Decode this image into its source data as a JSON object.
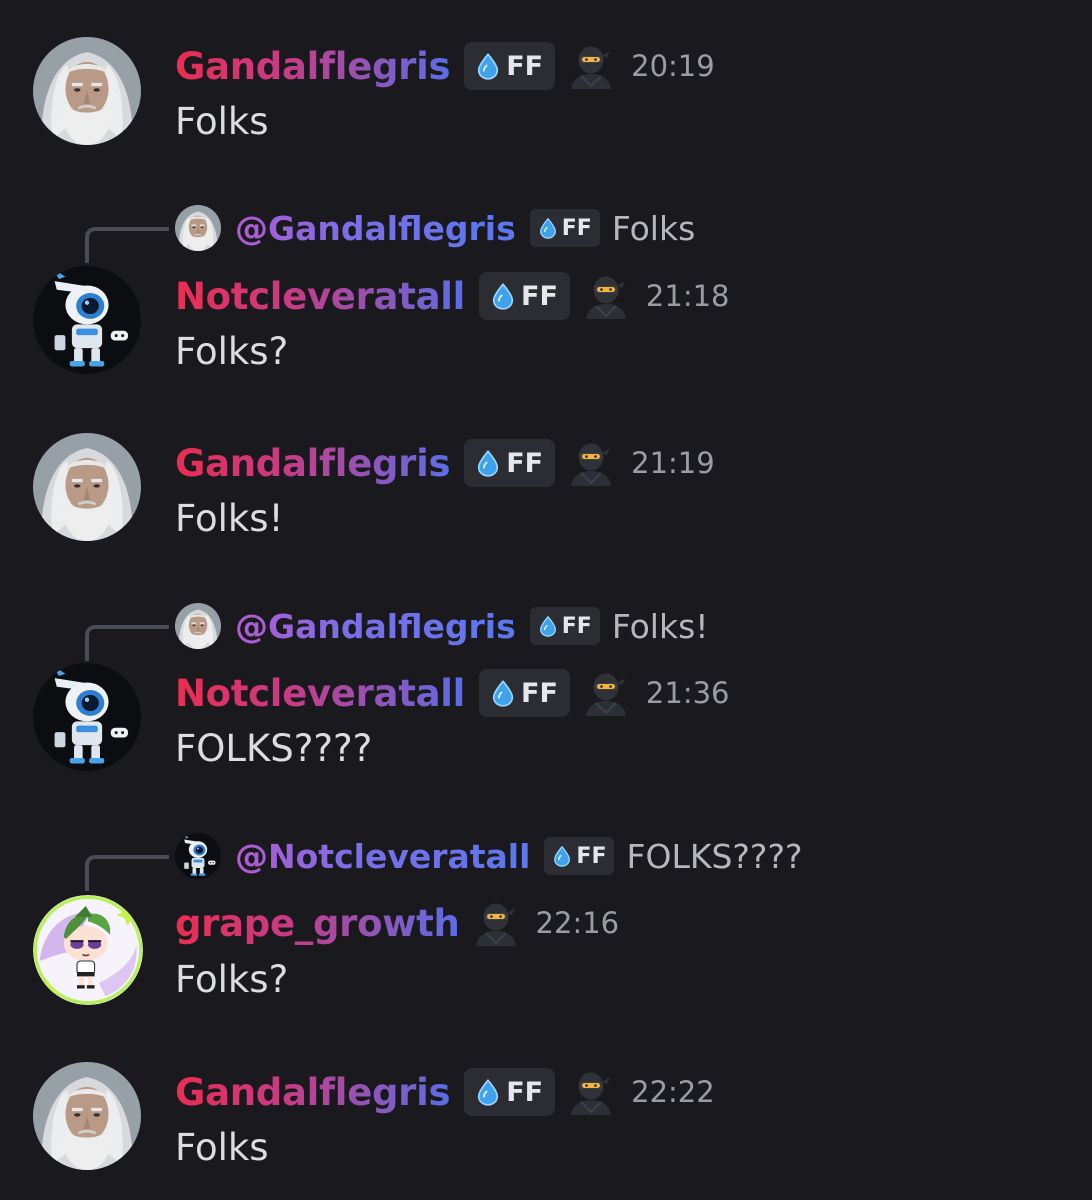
{
  "messages": [
    {
      "author": "Gandalflegris",
      "avatar_icon": "gandalf-avatar",
      "tag": "FF",
      "badge_icon": "ninja-emoji",
      "time": "20:19",
      "text": "Folks",
      "reply": null
    },
    {
      "author": "Notcleveratall",
      "avatar_icon": "robot-avatar",
      "tag": "FF",
      "badge_icon": "ninja-emoji",
      "time": "21:18",
      "text": "Folks?",
      "reply": {
        "author": "@Gandalflegris",
        "tag": "FF",
        "text": "Folks",
        "avatar_icon": "gandalf-avatar"
      }
    },
    {
      "author": "Gandalflegris",
      "avatar_icon": "gandalf-avatar",
      "tag": "FF",
      "badge_icon": "ninja-emoji",
      "time": "21:19",
      "text": "Folks!",
      "reply": null
    },
    {
      "author": "Notcleveratall",
      "avatar_icon": "robot-avatar",
      "tag": "FF",
      "badge_icon": "ninja-emoji",
      "time": "21:36",
      "text": "FOLKS????",
      "reply": {
        "author": "@Gandalflegris",
        "tag": "FF",
        "text": "Folks!",
        "avatar_icon": "gandalf-avatar"
      }
    },
    {
      "author": "grape_growth",
      "avatar_icon": "cartoon-girl-avatar",
      "tag": null,
      "badge_icon": "ninja-emoji",
      "time": "22:16",
      "text": "Folks?",
      "reply": {
        "author": "@Notcleveratall",
        "tag": "FF",
        "text": "FOLKS????",
        "avatar_icon": "robot-avatar"
      }
    },
    {
      "author": "Gandalflegris",
      "avatar_icon": "gandalf-avatar",
      "tag": "FF",
      "badge_icon": "ninja-emoji",
      "time": "22:22",
      "text": "Folks",
      "reply": null
    }
  ],
  "colors": {
    "background": "#1a1a1e",
    "tag_background": "#2b2d33",
    "username_gradient": [
      "#ea2d52",
      "#c83b85",
      "#5a6ee8"
    ],
    "timestamp": "#9a9ca4",
    "message_text": "#dcdde0"
  }
}
